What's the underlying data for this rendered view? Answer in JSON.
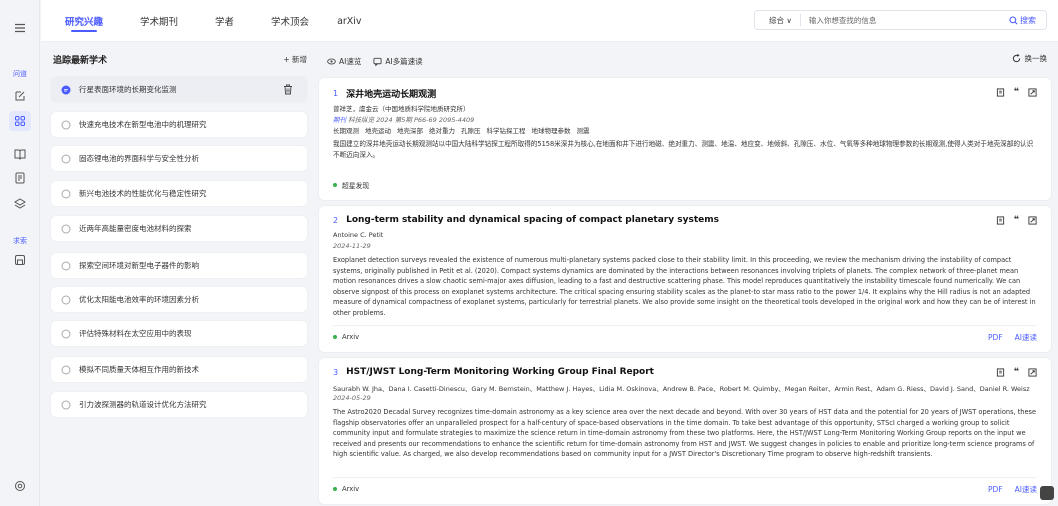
{
  "rail": {
    "ask_label": "问道",
    "search_label": "求索"
  },
  "nav": {
    "tabs": [
      "研究兴趣",
      "学术期刊",
      "学者",
      "学术顶会",
      "arXiv"
    ],
    "active_tab": 0
  },
  "search": {
    "scope": "综合 ∨",
    "placeholder": "输入你想查找的信息",
    "button": "搜索"
  },
  "left": {
    "title": "追踪最新学术",
    "add": "+ 新增",
    "topics": [
      "行星表面环境的长期变化监测",
      "快速充电技术在新型电池中的机理研究",
      "固态锂电池的界面科学与安全性分析",
      "新兴电池技术的性能优化与稳定性研究",
      "近两年高能量密度电池材料的探索",
      "探索空间环境对新型电子器件的影响",
      "优化太阳能电池效率的环境因素分析",
      "评估特殊材料在太空应用中的表现",
      "模拟不同质量天体相互作用的新技术",
      "引力波探测器的轨道设计优化方法研究"
    ],
    "selected": 0
  },
  "toolbar": {
    "ai_quick": "AI速览",
    "ai_multi": "AI多篇速读",
    "refresh": "换一换"
  },
  "papers": [
    {
      "num": "1",
      "title": "深井地壳运动长期观测",
      "authors": "曾祥芝，虞金云（中国地质科学院地质研究所）",
      "journal": "期刊",
      "journal_info": "科技纵览 2024 第5期 P66-69 2095-4409",
      "keywords": [
        "长期观测",
        "地壳运动",
        "地壳深部",
        "绝对重力",
        "孔隙压",
        "科学钻探工程",
        "地球物理参数",
        "测震"
      ],
      "abstract": "我国建立的深井地壳运动长期观测站以中国大陆科学钻探工程所取得的5158米深井为核心,在地面和井下进行地磁、绝对重力、测震、地温、地应变、地倾斜、孔隙压、水位、气氧等多种地球物理参数的长期观测,使得人类对于地壳深部的认识不断迈向深入。",
      "source": "超星发现",
      "links": []
    },
    {
      "num": "2",
      "title": "Long-term stability and dynamical spacing of compact planetary systems",
      "authors": "Antoine C. Petit",
      "date": "2024-11-29",
      "abstract": "Exoplanet detection surveys revealed the existence of numerous multi-planetary systems packed close to their stability limit. In this proceeding, we review the mechanism driving the instability of compact systems, originally published in Petit et al. (2020). Compact systems dynamics are dominated by the interactions between resonances involving triplets of planets. The complex network of three-planet mean motion resonances drives a slow chaotic semi-major axes diffusion, leading to a fast and destructive scattering phase. This model reproduces quantitatively the instability timescale found numerically. We can observe signpost of this process on exoplanet systems architecture. The critical spacing ensuring stability scales as the planet-to star mass ratio to the power 1/4. It explains why the Hill radius is not an adapted measure of dynamical compactness of exoplanet systems, particularly for terrestrial planets. We also provide some insight on the theoretical tools developed in the original work and how they can be of interest in other problems.",
      "source": "Arxiv",
      "links": [
        "PDF",
        "AI速读"
      ]
    },
    {
      "num": "3",
      "title": "HST/JWST Long-Term Monitoring Working Group Final Report",
      "authors": "Saurabh W. Jha、Dana I. Casetti-Dinescu、Gary M. Bernstein、Matthew J. Hayes、Lidia M. Oskinova、Andrew B. Pace、Robert M. Quimby、Megan Reiter、Armin Rest、Adam G. Riess、David J. Sand、Daniel R. Weisz",
      "date": "2024-05-29",
      "abstract": "The Astro2020 Decadal Survey recognizes time-domain astronomy as a key science area over the next decade and beyond. With over 30 years of HST data and the potential for 20 years of JWST operations, these flagship observatories offer an unparalleled prospect for a half-century of space-based observations in the time domain. To take best advantage of this opportunity, STScI charged a working group to solicit community input and formulate strategies to maximize the science return in time-domain astronomy from these two platforms. Here, the HST/JWST Long-Term Monitoring Working Group reports on the input we received and presents our recommendations to enhance the scientific return for time-domain astronomy from HST and JWST. We suggest changes in policies to enable and prioritize long-term science programs of high scientific value. As charged, we also develop recommendations based on community input for a JWST Director's Discretionary Time program to observe high-redshift transients.",
      "source": "Arxiv",
      "links": [
        "PDF",
        "AI速读"
      ]
    }
  ]
}
